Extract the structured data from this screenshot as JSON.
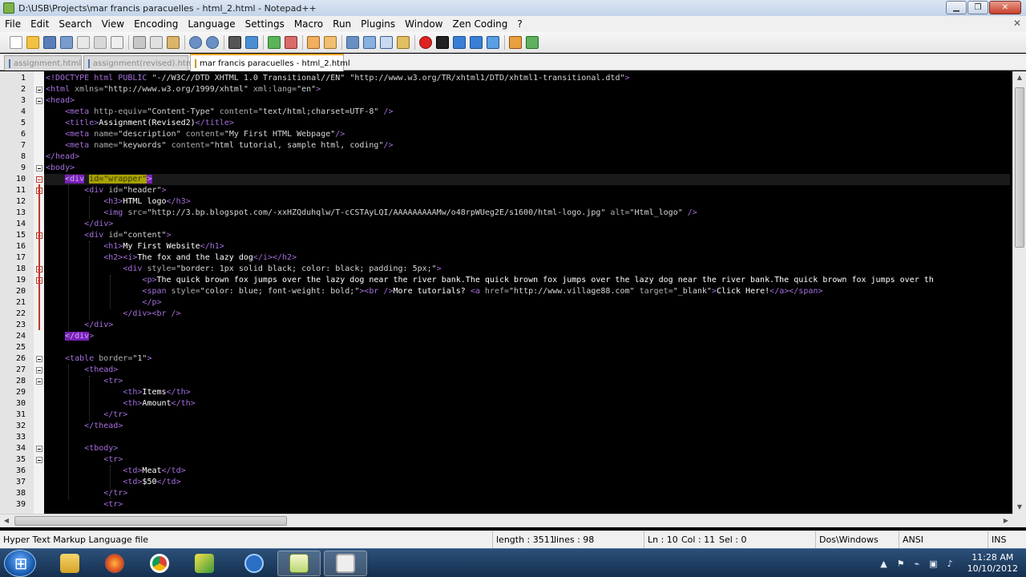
{
  "window": {
    "title": "D:\\USB\\Projects\\mar francis paracuelles - html_2.html - Notepad++"
  },
  "menu": [
    "File",
    "Edit",
    "Search",
    "View",
    "Encoding",
    "Language",
    "Settings",
    "Macro",
    "Run",
    "Plugins",
    "Window",
    "Zen Coding",
    "?"
  ],
  "tabs": [
    {
      "label": "assignment.html",
      "active": false
    },
    {
      "label": "assignment(revised).html",
      "active": false
    },
    {
      "label": "mar francis paracuelles - html_2.html",
      "active": true
    }
  ],
  "editor": {
    "current_line": 10,
    "lines": [
      {
        "n": "1",
        "segs": [
          [
            "t",
            "<!DOCTYPE html PUBLIC "
          ],
          [
            "s",
            "\"-//W3C//DTD XHTML 1.0 Transitional//EN\""
          ],
          [
            "dt",
            " "
          ],
          [
            "s",
            "\"http://www.w3.org/TR/xhtml1/DTD/xhtml1-transitional.dtd\""
          ],
          [
            "t",
            ">"
          ]
        ]
      },
      {
        "n": "2",
        "segs": [
          [
            "t",
            "<html "
          ],
          [
            "a",
            "xmlns="
          ],
          [
            "s",
            "\"http://www.w3.org/1999/xhtml\" "
          ],
          [
            "a",
            "xml:lang="
          ],
          [
            "s",
            "\"en\""
          ],
          [
            "t",
            ">"
          ]
        ]
      },
      {
        "n": "3",
        "segs": [
          [
            "t",
            "<head>"
          ]
        ]
      },
      {
        "n": "4",
        "segs": [
          [
            "dt",
            "    "
          ],
          [
            "t",
            "<meta "
          ],
          [
            "a",
            "http-equiv="
          ],
          [
            "s",
            "\"Content-Type\" "
          ],
          [
            "a",
            "content="
          ],
          [
            "s",
            "\"text/html;charset=UTF-8\" "
          ],
          [
            "t",
            "/>"
          ]
        ]
      },
      {
        "n": "5",
        "segs": [
          [
            "dt",
            "    "
          ],
          [
            "t",
            "<title>"
          ],
          [
            "tx",
            "Assignment(Revised2)"
          ],
          [
            "t",
            "</title>"
          ]
        ]
      },
      {
        "n": "6",
        "segs": [
          [
            "dt",
            "    "
          ],
          [
            "t",
            "<meta "
          ],
          [
            "a",
            "name="
          ],
          [
            "s",
            "\"description\" "
          ],
          [
            "a",
            "content="
          ],
          [
            "s",
            "\"My First HTML Webpage\""
          ],
          [
            "t",
            "/>"
          ]
        ]
      },
      {
        "n": "7",
        "segs": [
          [
            "dt",
            "    "
          ],
          [
            "t",
            "<meta "
          ],
          [
            "a",
            "name="
          ],
          [
            "s",
            "\"keywords\" "
          ],
          [
            "a",
            "content="
          ],
          [
            "s",
            "\"html tutorial, sample html, coding\""
          ],
          [
            "t",
            "/>"
          ]
        ]
      },
      {
        "n": "8",
        "segs": [
          [
            "t",
            "</head>"
          ]
        ]
      },
      {
        "n": "9",
        "segs": [
          [
            "t",
            "<body>"
          ]
        ]
      },
      {
        "n": "10",
        "segs": [
          [
            "dt",
            "    "
          ],
          [
            "tagsel",
            "<div"
          ],
          [
            "dt",
            " "
          ],
          [
            "hl",
            "id=\"wrapper\""
          ],
          [
            "tagsel",
            ">"
          ]
        ]
      },
      {
        "n": "11",
        "segs": [
          [
            "dt",
            "        "
          ],
          [
            "t",
            "<div "
          ],
          [
            "a",
            "id="
          ],
          [
            "s",
            "\"header\""
          ],
          [
            "t",
            ">"
          ]
        ]
      },
      {
        "n": "12",
        "segs": [
          [
            "dt",
            "            "
          ],
          [
            "t",
            "<h3>"
          ],
          [
            "tx",
            "HTML logo"
          ],
          [
            "t",
            "</h3>"
          ]
        ]
      },
      {
        "n": "13",
        "segs": [
          [
            "dt",
            "            "
          ],
          [
            "t",
            "<img "
          ],
          [
            "a",
            "src="
          ],
          [
            "s",
            "\"http://3.bp.blogspot.com/-xxHZQduhqlw/T-cCSTAyLQI/AAAAAAAAAMw/o48rpWUeg2E/s1600/html-logo.jpg\" "
          ],
          [
            "a",
            "alt="
          ],
          [
            "s",
            "\"Html_logo\" "
          ],
          [
            "t",
            "/>"
          ]
        ]
      },
      {
        "n": "14",
        "segs": [
          [
            "dt",
            "        "
          ],
          [
            "t",
            "</div>"
          ]
        ]
      },
      {
        "n": "15",
        "segs": [
          [
            "dt",
            "        "
          ],
          [
            "t",
            "<div "
          ],
          [
            "a",
            "id="
          ],
          [
            "s",
            "\"content\""
          ],
          [
            "t",
            ">"
          ]
        ]
      },
      {
        "n": "16",
        "segs": [
          [
            "dt",
            "            "
          ],
          [
            "t",
            "<h1>"
          ],
          [
            "tx",
            "My First Website"
          ],
          [
            "t",
            "</h1>"
          ]
        ]
      },
      {
        "n": "17",
        "segs": [
          [
            "dt",
            "            "
          ],
          [
            "t",
            "<h2><i>"
          ],
          [
            "tx",
            "The fox and the lazy dog"
          ],
          [
            "t",
            "</i></h2>"
          ]
        ]
      },
      {
        "n": "18",
        "segs": [
          [
            "dt",
            "                "
          ],
          [
            "t",
            "<div "
          ],
          [
            "a",
            "style="
          ],
          [
            "s",
            "\"border: 1px solid black; color: black; padding: 5px;\""
          ],
          [
            "t",
            ">"
          ]
        ]
      },
      {
        "n": "19",
        "segs": [
          [
            "dt",
            "                    "
          ],
          [
            "t",
            "<p>"
          ],
          [
            "tx",
            "The quick brown fox jumps over the lazy dog near the river bank.The quick brown fox jumps over the lazy dog near the river bank.The quick brown fox jumps over th"
          ]
        ]
      },
      {
        "n": "20",
        "segs": [
          [
            "dt",
            "                    "
          ],
          [
            "t",
            "<span "
          ],
          [
            "a",
            "style="
          ],
          [
            "s",
            "\"color: blue; font-weight: bold;\""
          ],
          [
            "t",
            "><br />"
          ],
          [
            "tx",
            "More tutorials? "
          ],
          [
            "t",
            "<a "
          ],
          [
            "a",
            "href="
          ],
          [
            "s",
            "\"http://www.village88.com\" "
          ],
          [
            "a",
            "target="
          ],
          [
            "s",
            "\"_blank\""
          ],
          [
            "t",
            ">"
          ],
          [
            "tx",
            "Click Here!"
          ],
          [
            "t",
            "</a></span>"
          ]
        ]
      },
      {
        "n": "21",
        "segs": [
          [
            "dt",
            "                    "
          ],
          [
            "t",
            "</p>"
          ]
        ]
      },
      {
        "n": "22",
        "segs": [
          [
            "dt",
            "                "
          ],
          [
            "t",
            "</div><br />"
          ]
        ]
      },
      {
        "n": "23",
        "segs": [
          [
            "dt",
            "        "
          ],
          [
            "t",
            "</div>"
          ]
        ]
      },
      {
        "n": "24",
        "segs": [
          [
            "dt",
            "    "
          ],
          [
            "tagsel",
            "</div"
          ],
          [
            "t",
            ">"
          ]
        ]
      },
      {
        "n": "25",
        "segs": []
      },
      {
        "n": "26",
        "segs": [
          [
            "dt",
            "    "
          ],
          [
            "t",
            "<table "
          ],
          [
            "a",
            "border="
          ],
          [
            "s",
            "\"1\""
          ],
          [
            "t",
            ">"
          ]
        ]
      },
      {
        "n": "27",
        "segs": [
          [
            "dt",
            "        "
          ],
          [
            "t",
            "<thead>"
          ]
        ]
      },
      {
        "n": "28",
        "segs": [
          [
            "dt",
            "            "
          ],
          [
            "t",
            "<tr>"
          ]
        ]
      },
      {
        "n": "29",
        "segs": [
          [
            "dt",
            "                "
          ],
          [
            "t",
            "<th>"
          ],
          [
            "tx",
            "Items"
          ],
          [
            "t",
            "</th>"
          ]
        ]
      },
      {
        "n": "30",
        "segs": [
          [
            "dt",
            "                "
          ],
          [
            "t",
            "<th>"
          ],
          [
            "tx",
            "Amount"
          ],
          [
            "t",
            "</th>"
          ]
        ]
      },
      {
        "n": "31",
        "segs": [
          [
            "dt",
            "            "
          ],
          [
            "t",
            "</tr>"
          ]
        ]
      },
      {
        "n": "32",
        "segs": [
          [
            "dt",
            "        "
          ],
          [
            "t",
            "</thead>"
          ]
        ]
      },
      {
        "n": "33",
        "segs": []
      },
      {
        "n": "34",
        "segs": [
          [
            "dt",
            "        "
          ],
          [
            "t",
            "<tbody>"
          ]
        ]
      },
      {
        "n": "35",
        "segs": [
          [
            "dt",
            "            "
          ],
          [
            "t",
            "<tr>"
          ]
        ]
      },
      {
        "n": "36",
        "segs": [
          [
            "dt",
            "                "
          ],
          [
            "t",
            "<td>"
          ],
          [
            "tx",
            "Meat"
          ],
          [
            "t",
            "</td>"
          ]
        ]
      },
      {
        "n": "37",
        "segs": [
          [
            "dt",
            "                "
          ],
          [
            "t",
            "<td>"
          ],
          [
            "tx",
            "$50"
          ],
          [
            "t",
            "</td>"
          ]
        ]
      },
      {
        "n": "38",
        "segs": [
          [
            "dt",
            "            "
          ],
          [
            "t",
            "</tr>"
          ]
        ]
      },
      {
        "n": "39",
        "segs": [
          [
            "dt",
            "            "
          ],
          [
            "t",
            "<tr>"
          ]
        ]
      }
    ]
  },
  "status": {
    "language": "Hyper Text Markup Language file",
    "length": "length : 3511",
    "lines": "lines : 98",
    "ln": "Ln : 10",
    "col": "Col : 11",
    "sel": "Sel : 0",
    "eol": "Dos\\Windows",
    "encoding": "ANSI",
    "mode": "INS"
  },
  "taskbar": {
    "time": "11:28 AM",
    "date": "10/10/2012"
  },
  "colors": {
    "editor_bg": "#000000",
    "tag": "#a56fdc",
    "attribute": "#b0b0b0",
    "value": "#d8d8d8",
    "highlight": "#a7a200"
  }
}
